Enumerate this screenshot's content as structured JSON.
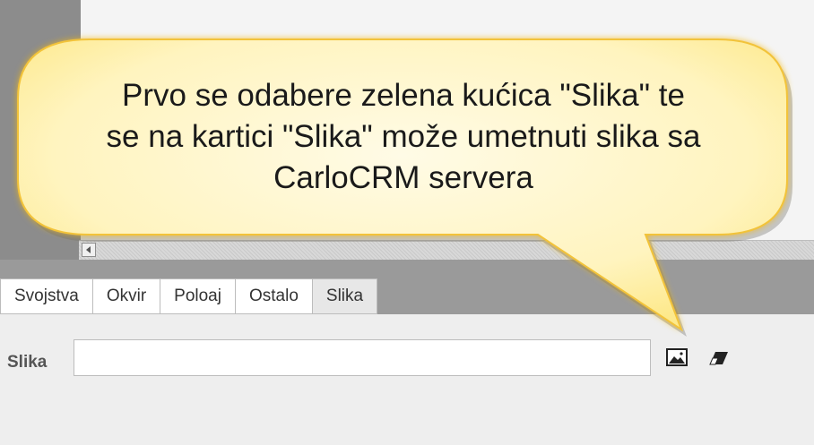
{
  "callout": {
    "line1": "Prvo se odabere zelena kućica \"Slika\" te",
    "line2": "se na kartici \"Slika\" može umetnuti slika sa",
    "line3": "CarloCRM servera"
  },
  "tabs": [
    {
      "label": "Svojstva",
      "active": false
    },
    {
      "label": "Okvir",
      "active": false
    },
    {
      "label": "Poloaj",
      "active": false
    },
    {
      "label": "Ostalo",
      "active": false
    },
    {
      "label": "Slika",
      "active": true
    }
  ],
  "form": {
    "label": "Slika",
    "value": "",
    "placeholder": ""
  },
  "icons": {
    "browse": "image-icon",
    "clear": "eraser-icon",
    "scroll_left": "scroll-left-arrow-icon"
  },
  "colors": {
    "bubble_fill": "#fdf3b4",
    "bubble_glow": "#f3b817",
    "tab_active": "#e7e7e7",
    "panel_bg": "#eeeeee"
  }
}
